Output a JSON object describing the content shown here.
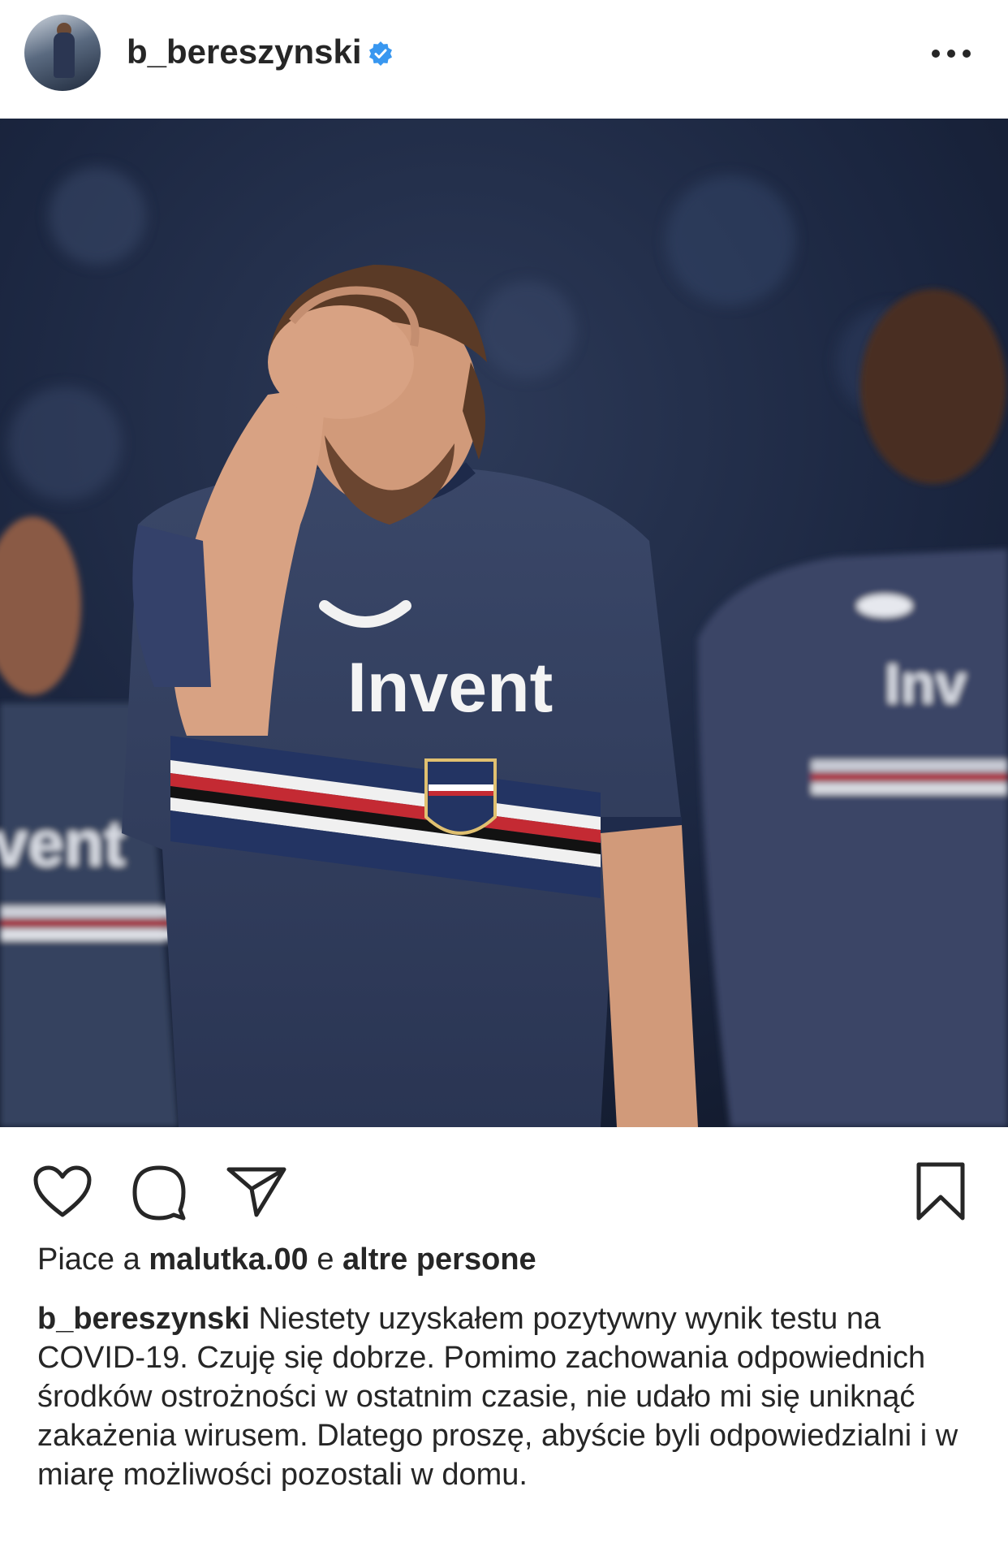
{
  "header": {
    "username": "b_bereszynski",
    "verified": true,
    "avatar_icon": "profile-photo",
    "more_icon": "more-horizontal-icon"
  },
  "post": {
    "image_alt": "Sampdoria player with hand on head",
    "jersey_text": "Invent"
  },
  "actions": {
    "icons": [
      "heart-icon",
      "comment-icon",
      "share-icon",
      "bookmark-icon"
    ]
  },
  "likes": {
    "prefix": "Piace a ",
    "user": "malutka.00",
    "middle": " e ",
    "others": "altre persone"
  },
  "caption": {
    "username": "b_bereszynski",
    "text": "Niestety uzyskałem pozytywny wynik testu na COVID-19.  Czuję się dobrze. Pomimo zachowania odpowiednich środków ostrożności w ostatnim czasie, nie udało mi się uniknąć zakażenia wirusem. Dlatego proszę, abyście byli odpowiedzialni i w miarę możliwości pozostali w domu."
  },
  "colors": {
    "verified_blue": "#3897f0",
    "text": "#262626",
    "jersey_navy": "#2e3a5c"
  }
}
